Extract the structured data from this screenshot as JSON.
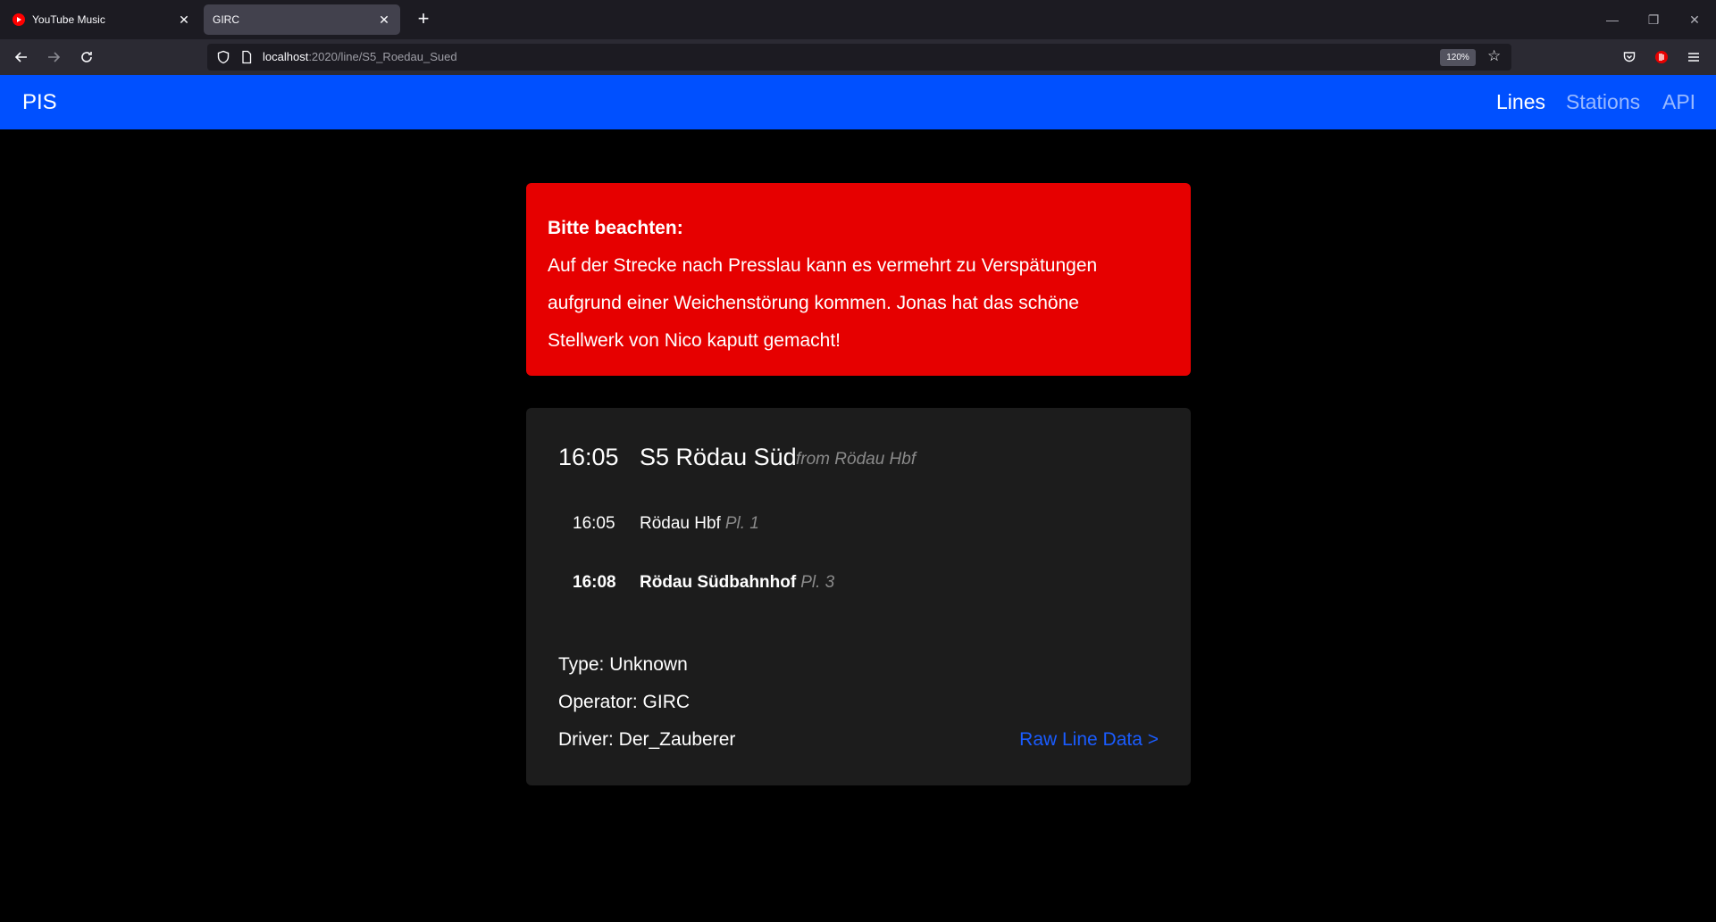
{
  "browser": {
    "tabs": [
      {
        "title": "YouTube Music",
        "close": "✕"
      },
      {
        "title": "GIRC",
        "close": "✕"
      }
    ],
    "new_tab": "+",
    "window_controls": {
      "minimize": "—",
      "restore": "❐",
      "close": "✕"
    },
    "url_host": "localhost",
    "url_rest": ":2020/line/S5_Roedau_Sued",
    "zoom": "120%",
    "icons": [
      "back-icon",
      "forward-icon",
      "reload-icon",
      "shield-icon",
      "page-icon",
      "bookmark-star-icon",
      "pocket-icon",
      "extension-icon",
      "menu-icon"
    ]
  },
  "nav": {
    "brand": "PIS",
    "links": [
      {
        "label": "Lines",
        "active": true
      },
      {
        "label": "Stations",
        "active": false
      },
      {
        "label": "API",
        "active": false
      }
    ],
    "accent": "#0050ff"
  },
  "alert": {
    "title": "Bitte beachten:",
    "lines": [
      "Auf der Strecke nach Presslau kann es vermehrt zu Verspätungen",
      "aufgrund einer Weichenstörung kommen. Jonas hat das schöne",
      "Stellwerk von Nico kaputt gemacht!"
    ],
    "color": "#e60000"
  },
  "line": {
    "departure": "16:05",
    "name": "S5 Rödau Süd",
    "from": "from Rödau Hbf",
    "stops": [
      {
        "time": "16:05",
        "station": "Rödau Hbf",
        "platform": "Pl. 1",
        "bold": false
      },
      {
        "time": "16:08",
        "station": "Rödau Südbahnhof",
        "platform": "Pl. 3",
        "bold": true
      }
    ],
    "type": "Type: Unknown",
    "operator": "Operator: GIRC",
    "driver": "Driver: Der_Zauberer",
    "raw_link": "Raw Line Data >"
  }
}
